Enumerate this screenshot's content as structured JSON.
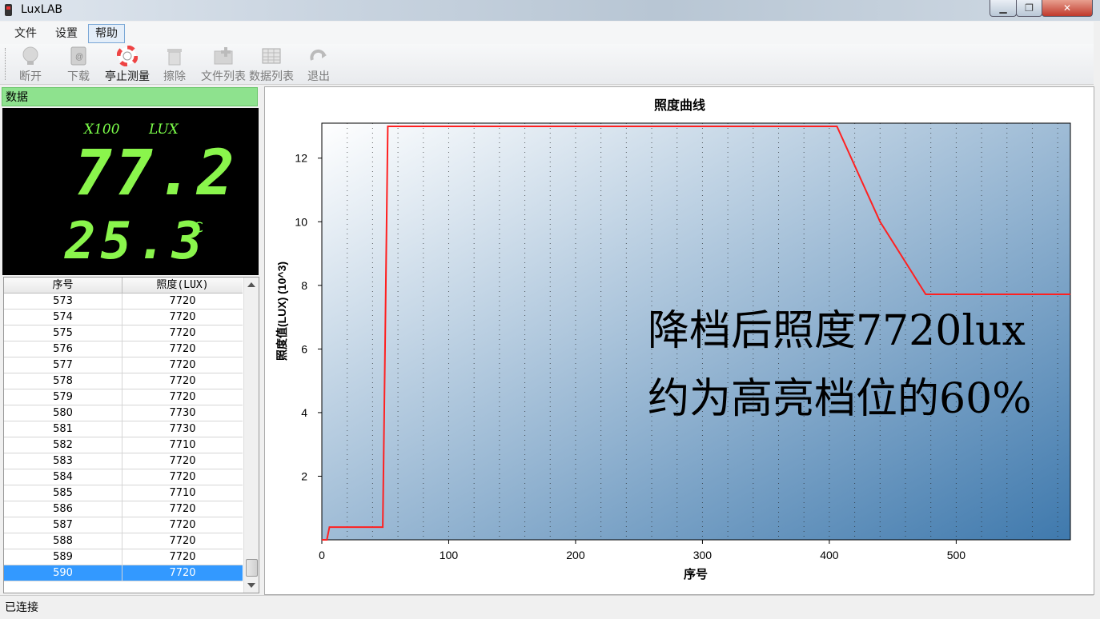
{
  "window": {
    "title": "LuxLAB",
    "min_label": "▁",
    "max_label": "❐",
    "close_label": "✕"
  },
  "menu": {
    "items": [
      "文件",
      "设置",
      "帮助"
    ],
    "active": "帮助"
  },
  "toolbar": {
    "buttons": [
      {
        "label": "断开",
        "icon": "bulb-icon",
        "enabled": false
      },
      {
        "label": "下载",
        "icon": "book-icon",
        "enabled": false
      },
      {
        "label": "亭止测量",
        "icon": "lifebuoy-icon",
        "enabled": true
      },
      {
        "label": "擦除",
        "icon": "trash-icon",
        "enabled": false
      },
      {
        "label": "文件列表",
        "icon": "folder-add-icon",
        "enabled": false
      },
      {
        "label": "数据列表",
        "icon": "table-icon",
        "enabled": false
      },
      {
        "label": "退出",
        "icon": "redo-icon",
        "enabled": false
      }
    ]
  },
  "data_panel": {
    "header": "数据",
    "lcd": {
      "multiplier": "X100",
      "unit": "LUX",
      "lux_value": "77.2",
      "temperature": "25.3",
      "temp_unit": "℃"
    },
    "table": {
      "columns": [
        "序号",
        "照度(LUX)"
      ],
      "rows": [
        [
          "573",
          "7720"
        ],
        [
          "574",
          "7720"
        ],
        [
          "575",
          "7720"
        ],
        [
          "576",
          "7720"
        ],
        [
          "577",
          "7720"
        ],
        [
          "578",
          "7720"
        ],
        [
          "579",
          "7720"
        ],
        [
          "580",
          "7730"
        ],
        [
          "581",
          "7730"
        ],
        [
          "582",
          "7710"
        ],
        [
          "583",
          "7720"
        ],
        [
          "584",
          "7720"
        ],
        [
          "585",
          "7710"
        ],
        [
          "586",
          "7720"
        ],
        [
          "587",
          "7720"
        ],
        [
          "588",
          "7720"
        ],
        [
          "589",
          "7720"
        ],
        [
          "590",
          "7720"
        ]
      ],
      "selected_index": 17
    }
  },
  "chart_data": {
    "type": "line",
    "title": "照度曲线",
    "xlabel": "序号",
    "ylabel": "照度值(LUX)  (10^3)",
    "xlim": [
      0,
      590
    ],
    "ylim": [
      0,
      13.1
    ],
    "xticks": [
      0,
      100,
      200,
      300,
      400,
      500
    ],
    "yticks": [
      2,
      4,
      6,
      8,
      10,
      12
    ],
    "grid": "dotted vertical",
    "series": [
      {
        "color": "#ff2020",
        "x": [
          0,
          4,
          6,
          48,
          50,
          52,
          150,
          300,
          406,
          440,
          476,
          520,
          590
        ],
        "y": [
          0,
          0,
          0.4,
          0.4,
          6.5,
          13.0,
          13.0,
          13.0,
          13.0,
          10.0,
          7.72,
          7.72,
          7.72
        ]
      }
    ],
    "annotations": [
      "降档后照度7720lux",
      "约为高亮档位的60%"
    ],
    "colors": {
      "bg_light": "#ffffff",
      "bg_dark": "#3f79ad",
      "line": "#ff2020"
    }
  },
  "status": {
    "text": "已连接"
  }
}
